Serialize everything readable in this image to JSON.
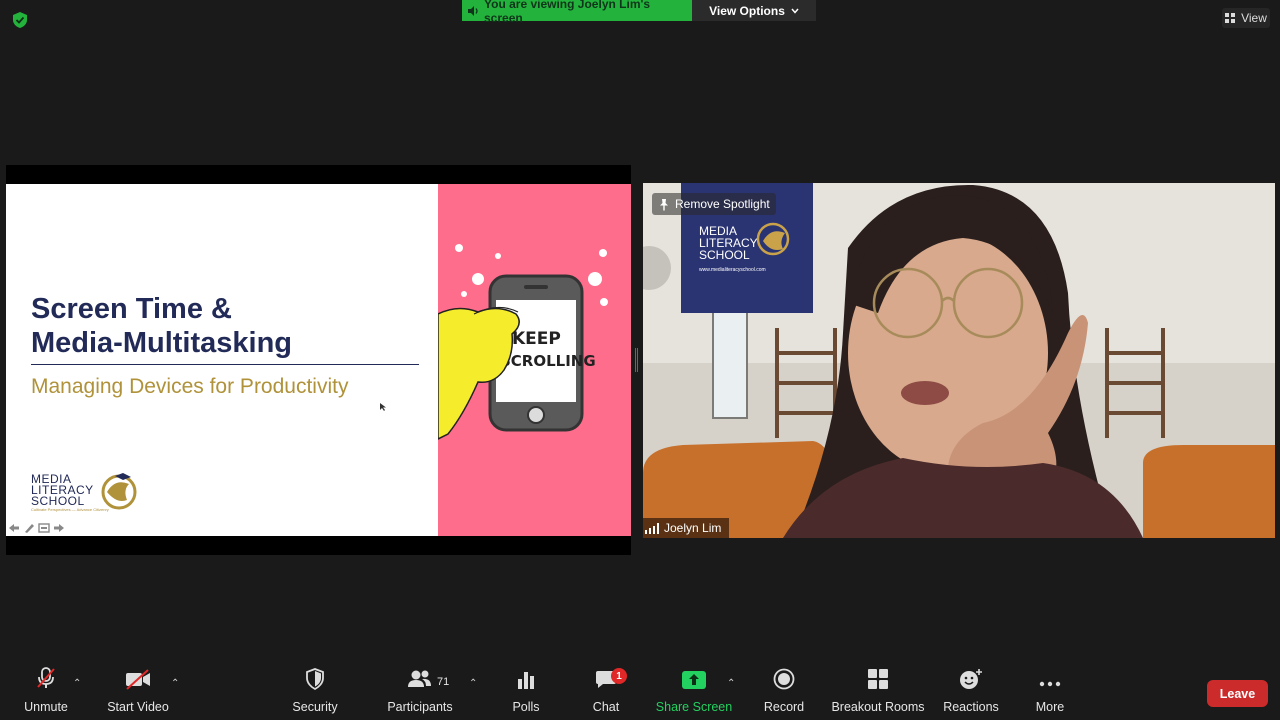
{
  "top_bar": {
    "viewing_banner": "You are viewing Joelyn Lim's screen",
    "view_options": "View Options",
    "view_button": "View"
  },
  "shared_slide": {
    "title": "Screen Time &\nMedia-Multitasking",
    "subtitle": "Managing Devices for Productivity",
    "logo_text": "MEDIA LITERACY SCHOOL",
    "logo_tagline": "Cultivate Perspectives — Advance Citizenry",
    "phone_text": "KEEP SCROLLING",
    "accent_pink": "#ff6d8c",
    "title_color": "#222a57",
    "subtitle_color": "#b0923a"
  },
  "video_tile": {
    "spotlight_button": "Remove Spotlight",
    "participant_name": "Joelyn Lim",
    "banner_logo_text": "MEDIA LITERACY SCHOOL",
    "banner_url": "www.medialiteracyschool.com"
  },
  "toolbar": {
    "unmute": "Unmute",
    "start_video": "Start Video",
    "security": "Security",
    "participants": "Participants",
    "participants_count": "71",
    "polls": "Polls",
    "chat": "Chat",
    "chat_badge": "1",
    "share_screen": "Share Screen",
    "record": "Record",
    "breakout_rooms": "Breakout Rooms",
    "reactions": "Reactions",
    "more": "More",
    "leave": "Leave",
    "share_color": "#23d160",
    "leave_color": "#cc2b2b"
  }
}
